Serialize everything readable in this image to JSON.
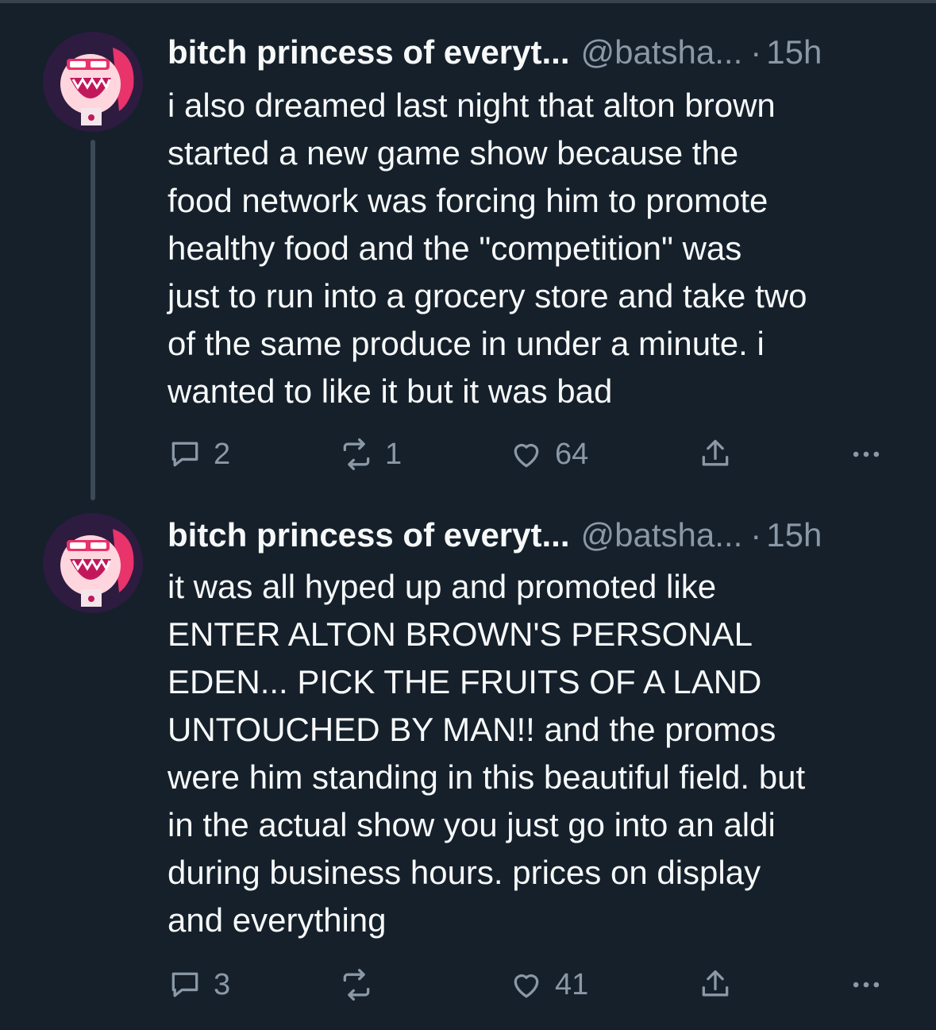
{
  "tweets": [
    {
      "display_name": "bitch princess of everyt...",
      "handle": "@batsha...",
      "separator": "·",
      "time": "15h",
      "avatar_icon": "avatar-cartoon-pink-character",
      "text": "i also dreamed last night that alton brown\nstarted a new game show because the\nfood network was forcing him to promote\nhealthy food and the \"competition\" was\njust to run into a grocery store and take two\nof the same produce in under a minute. i\nwanted to like it but it was bad",
      "replies": "2",
      "retweets": "1",
      "likes": "64"
    },
    {
      "display_name": "bitch princess of everyt...",
      "handle": "@batsha...",
      "separator": "·",
      "time": "15h",
      "avatar_icon": "avatar-cartoon-pink-character",
      "text": "it was all hyped up and promoted like\nENTER ALTON BROWN'S PERSONAL\nEDEN... PICK THE FRUITS OF A LAND\nUNTOUCHED BY MAN!! and the promos\nwere him standing in this beautiful field. but\nin the actual show you just go into an aldi\nduring business hours. prices on display\nand everything",
      "replies": "3",
      "retweets": "",
      "likes": "41"
    }
  ],
  "colors": {
    "background": "#15202b",
    "text": "#f7f9f9",
    "muted": "#8b98a5",
    "thread_line": "#3c4a57",
    "avatar_accent": "#e8336b"
  }
}
